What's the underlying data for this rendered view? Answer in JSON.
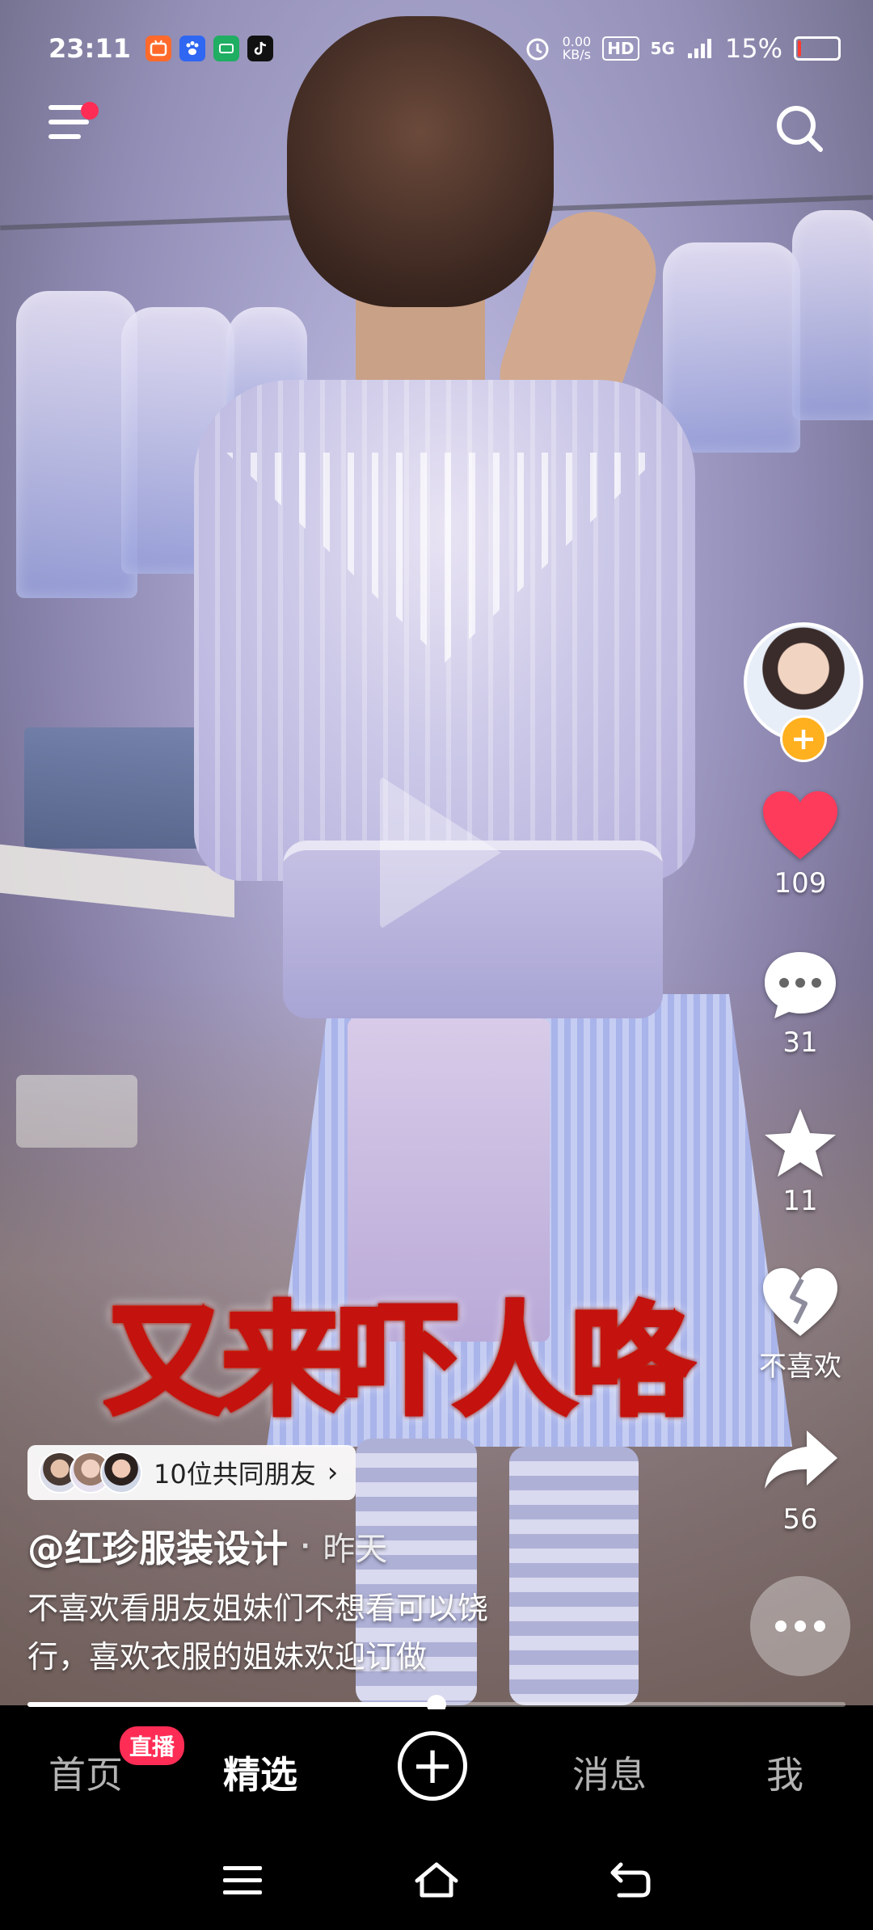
{
  "status_bar": {
    "time": "23:11",
    "net_speed_value": "0.00",
    "net_speed_unit": "KB/s",
    "hd_label": "HD",
    "network_label": "5G",
    "battery_percent": "15%",
    "battery_level": 0.15,
    "app_icons": [
      "bilibili-icon",
      "baidu-icon",
      "sohu-icon",
      "tiktok-icon"
    ]
  },
  "top": {
    "menu_icon": "hamburger-menu-icon",
    "search_icon": "search-icon"
  },
  "rail": {
    "like_count": "109",
    "comment_count": "31",
    "favorite_count": "11",
    "dislike_label": "不喜欢",
    "share_count": "56"
  },
  "video": {
    "caption_overlay": "又来吓人咯",
    "progress": 0.5
  },
  "info": {
    "friends_chip_label": "10位共同朋友",
    "chevron": "›",
    "author": "@红珍服装设计",
    "separator": "·",
    "posted_time": "昨天",
    "description_line1": "不喜欢看朋友姐妹们不想看可以饶",
    "description_line2": "行，喜欢衣服的姐妹欢迎订做"
  },
  "tabs": {
    "home": "首页",
    "live_badge": "直播",
    "featured": "精选",
    "plus": "+",
    "messages": "消息",
    "me": "我"
  },
  "colors": {
    "like_red": "#ff3b5c",
    "badge_red": "#ff2d55",
    "follow_orange": "#ffb01f"
  }
}
